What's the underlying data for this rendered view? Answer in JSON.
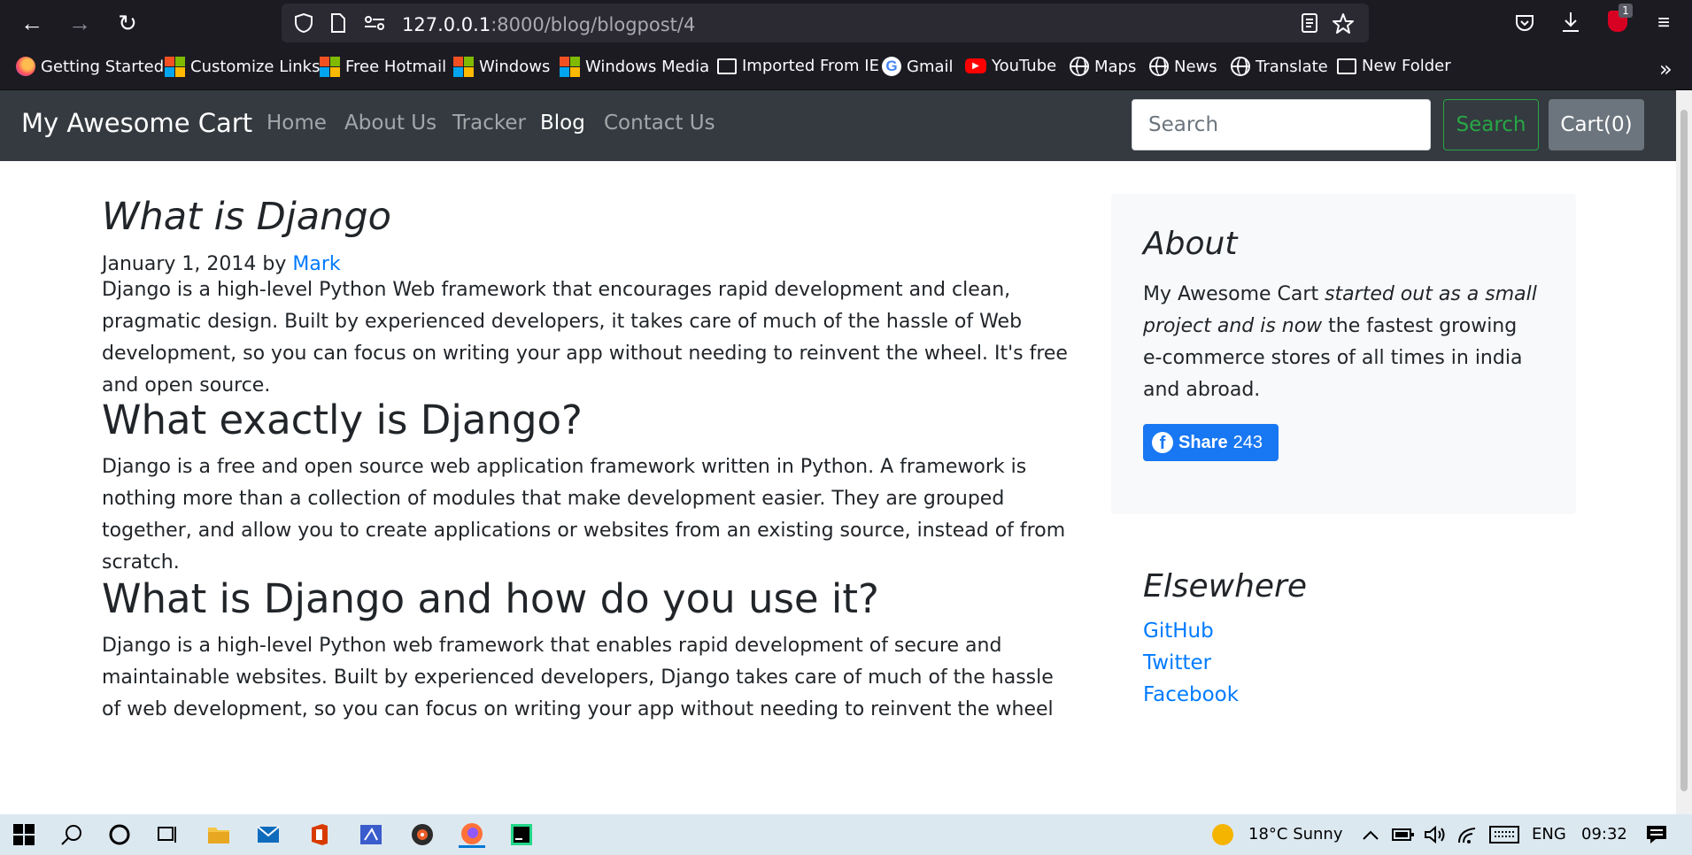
{
  "browser": {
    "url_host": "127.0.0.1",
    "url_rest": ":8000/blog/blogpost/4",
    "extension_badge": "1"
  },
  "bookmarks": [
    {
      "label": "Getting Started",
      "icon": "firefox-icon"
    },
    {
      "label": "Customize Links",
      "icon": "windows-logo-icon"
    },
    {
      "label": "Free Hotmail",
      "icon": "windows-logo-icon"
    },
    {
      "label": "Windows",
      "icon": "windows-logo-icon"
    },
    {
      "label": "Windows Media",
      "icon": "windows-logo-icon"
    },
    {
      "label": "Imported From IE",
      "icon": "folder-icon"
    },
    {
      "label": "Gmail",
      "icon": "google-icon"
    },
    {
      "label": "YouTube",
      "icon": "youtube-icon"
    },
    {
      "label": "Maps",
      "icon": "globe-icon"
    },
    {
      "label": "News",
      "icon": "globe-icon"
    },
    {
      "label": "Translate",
      "icon": "globe-icon"
    },
    {
      "label": "New Folder",
      "icon": "folder-icon"
    }
  ],
  "site": {
    "brand": "My Awesome Cart",
    "nav": [
      "Home",
      "About Us",
      "Tracker",
      "Blog",
      "Contact Us"
    ],
    "active_nav": "Blog",
    "search_placeholder": "Search",
    "search_button": "Search",
    "cart_button": "Cart(0)"
  },
  "post": {
    "title": "What is Django",
    "date": "January 1, 2014",
    "by": "by",
    "author": "Mark",
    "intro": "Django is a high-level Python Web framework that encourages rapid development and clean, pragmatic design. Built by experienced developers, it takes care of much of the hassle of Web development, so you can focus on writing your app without needing to reinvent the wheel. It's free and open source.",
    "section1_heading": "What exactly is Django?",
    "section1_text": "Django is a free and open source web application framework written in Python. A framework is nothing more than a collection of modules that make development easier. They are grouped together, and allow you to create applications or websites from an existing source, instead of from scratch.",
    "section2_heading": "What is Django and how do you use it?",
    "section2_text": "Django is a high-level Python web framework that enables rapid development of secure and maintainable websites. Built by experienced developers, Django takes care of much of the hassle of web development, so you can focus on writing your app without needing to reinvent the wheel"
  },
  "sidebar": {
    "about_title": "About",
    "about_text_1": "My Awesome Cart ",
    "about_text_2": "started out as a small project and is now",
    "about_text_3": " the fastest growing e-commerce stores of all times in india and abroad.",
    "share_label": "Share",
    "share_count": "243",
    "elsewhere_title": "Elsewhere",
    "links": [
      "GitHub",
      "Twitter",
      "Facebook"
    ]
  },
  "taskbar": {
    "weather": "18°C  Sunny",
    "language": "ENG",
    "time": "09:32"
  }
}
